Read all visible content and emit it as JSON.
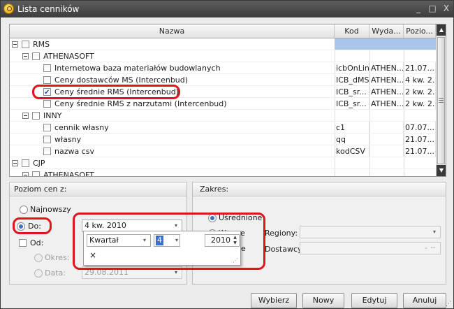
{
  "window": {
    "title": "Lista cenników",
    "min": "_",
    "max": "□",
    "close": "X"
  },
  "tree": {
    "columns": [
      "Nazwa",
      "Kod",
      "Wyda...",
      "Pozio..."
    ],
    "rows": [
      {
        "label": "RMS",
        "level": 0,
        "expander": true,
        "checked": false,
        "kod": "",
        "wyd": "",
        "poz": "",
        "selected": true
      },
      {
        "label": "ATHENASOFT",
        "level": 1,
        "expander": true,
        "checked": false,
        "kod": "",
        "wyd": "",
        "poz": ""
      },
      {
        "label": "Internetowa baza materiałów budowlanych",
        "level": 2,
        "expander": false,
        "checked": false,
        "kod": "icbOnLine",
        "wyd": "ATHEN...",
        "poz": "21.07...."
      },
      {
        "label": "Ceny dostawców MS (Intercenbud)",
        "level": 2,
        "expander": false,
        "checked": false,
        "kod": "ICB_dMS",
        "wyd": "ATHEN...",
        "poz": "4 kw. 2..."
      },
      {
        "label": "Ceny średnie RMS (Intercenbud)",
        "level": 2,
        "expander": false,
        "checked": true,
        "kod": "ICB_sr...",
        "wyd": "ATHEN...",
        "poz": "2 kw. 2..."
      },
      {
        "label": "Ceny średnie RMS z narzutami (Intercenbud)",
        "level": 2,
        "expander": false,
        "checked": false,
        "kod": "ICB_sr...",
        "wyd": "ATHEN...",
        "poz": "2 kw. 2..."
      },
      {
        "label": "INNY",
        "level": 1,
        "expander": true,
        "checked": false,
        "kod": "",
        "wyd": "",
        "poz": ""
      },
      {
        "label": "cennik własny",
        "level": 2,
        "expander": false,
        "checked": false,
        "kod": "c1",
        "wyd": "",
        "poz": "07.07...."
      },
      {
        "label": "własny",
        "level": 2,
        "expander": false,
        "checked": false,
        "kod": "qq",
        "wyd": "",
        "poz": "21.07...."
      },
      {
        "label": "nazwa csv",
        "level": 2,
        "expander": false,
        "checked": false,
        "kod": "kodCSV",
        "wyd": "",
        "poz": "21.07...."
      },
      {
        "label": "CJP",
        "level": 0,
        "expander": true,
        "checked": false,
        "kod": "",
        "wyd": "",
        "poz": ""
      },
      {
        "label": "ATHENASOFT",
        "level": 1,
        "expander": true,
        "checked": false,
        "kod": "",
        "wyd": "",
        "poz": ""
      }
    ]
  },
  "poziom": {
    "header": "Poziom cen z:",
    "najnowszy": "Najnowszy",
    "do": "Do:",
    "do_value": "4 kw. 2010",
    "od": "Od:",
    "okres": "Okres:",
    "data": "Data:",
    "data_value": "29.08.2011"
  },
  "popup": {
    "period_type": "Kwartał",
    "quarter": "4",
    "year": "2010",
    "clear": "×"
  },
  "zakres": {
    "header": "Zakres:",
    "usrednione": "Uśrednione",
    "wybrane_partial": "W",
    "wybrane_partial_end": "e",
    "wszystkie_partial": "e",
    "regiony": "Regiony:",
    "dostawcy": "Dostawcy:",
    "dostawcy_placeholder": "-"
  },
  "buttons": {
    "wybierz": "Wybierz",
    "nowy": "Nowy",
    "edytuj": "Edytuj",
    "anuluj": "Anuluj"
  },
  "colors": {
    "highlight": "#e0141e",
    "selection": "#a9c6ea",
    "radio_on": "#3a6fc8"
  }
}
